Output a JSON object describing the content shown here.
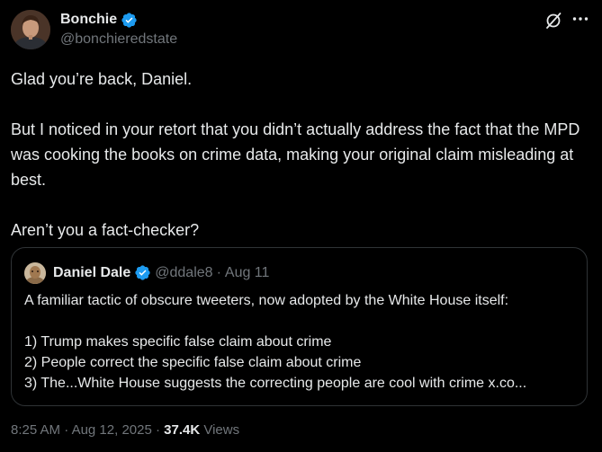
{
  "author": {
    "display_name": "Bonchie",
    "handle": "@bonchieredstate",
    "verified": true
  },
  "icons": {
    "verified": "verified-badge-icon",
    "grok": "grok-icon",
    "more": "more-options-icon"
  },
  "tweet": {
    "paragraphs": [
      "Glad you’re back, Daniel.",
      "But I noticed in your retort that you didn’t actually address the fact that the MPD was cooking the books on crime data, making your original claim misleading at best.",
      "Aren’t you a fact-checker?"
    ]
  },
  "quote": {
    "display_name": "Daniel Dale",
    "handle": "@ddale8",
    "separator": "·",
    "date": "Aug 11",
    "line1": "A familiar tactic of obscure tweeters, now adopted by the White House itself:",
    "item1": "1) Trump makes specific false claim about crime",
    "item2": "2) People correct the specific false claim about crime",
    "item3": "3) The...White House suggests the correcting people are cool with crime x.co..."
  },
  "meta": {
    "time": "8:25 AM",
    "sep1": "·",
    "date": "Aug 12, 2025",
    "sep2": "·",
    "views_count": "37.4K",
    "views_label": "Views"
  },
  "colors": {
    "background": "#000000",
    "text_primary": "#e7e9ea",
    "text_secondary": "#71767b",
    "verified": "#1d9bf0",
    "border": "#2f3336"
  }
}
